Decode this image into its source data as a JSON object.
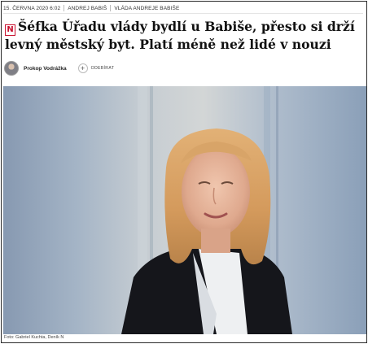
{
  "meta": {
    "date": "15. ČERVNA 2020 6:02",
    "tags": [
      "ANDREJ BABIŠ",
      "VLÁDA ANDREJE BABIŠE"
    ]
  },
  "headline": {
    "badge": "N",
    "text": "Šéfka Úřadu vlády bydlí u Babiše, přesto si drží levný městský byt. Platí méně než lidé v nouzi"
  },
  "author": {
    "name": "Prokop Vodrážka",
    "follow_label": "ODEBÍRAT",
    "follow_icon": "+"
  },
  "photo": {
    "caption": "Foto: Gabriel Kuchta, Deník N"
  }
}
